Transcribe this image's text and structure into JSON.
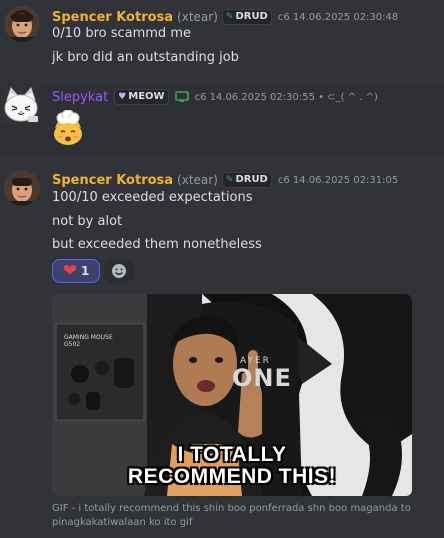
{
  "colors": {
    "background": "#313338",
    "spencer_name": "#f0b232",
    "slepykat_name": "#9b59f6",
    "tag_green": "#3ba55c",
    "reaction_border": "#5865f2",
    "reaction_bg": "#3c4270",
    "heart": "#ed4245"
  },
  "messages": [
    {
      "username": "Spencer Kotrosa",
      "handle": "(xtear)",
      "tag": "DRUD",
      "tag_icon": "feather-icon",
      "timestamp": "c6 14.06.2025 02:30:48",
      "lines": [
        "0/10 bro scammd me",
        "jk bro did an outstanding job"
      ]
    },
    {
      "username": "Slepykat",
      "tag": "MEOW",
      "tag_icon": "heart-icon",
      "device_icon": "monitor-icon",
      "timestamp": "c6 14.06.2025 02:30:55 • ⊂_( ^ . ^)",
      "emoji": "chef-cat-emoji"
    },
    {
      "username": "Spencer Kotrosa",
      "handle": "(xtear)",
      "tag": "DRUD",
      "tag_icon": "feather-icon",
      "timestamp": "c6 14.06.2025 02:31:05",
      "lines": [
        "100/10 exceeded expectations",
        "not by alot",
        "but exceeded them nonetheless"
      ],
      "reaction": {
        "emoji": "heart-emoji",
        "count": "1"
      },
      "add_reaction_icon": "smiley-plus-icon",
      "gif": {
        "caption_line1": "I TOTALLY",
        "caption_line2": "RECOMMEND THIS!",
        "poster_text": "GAMING MOUSE G502",
        "chair_text": "ONE",
        "chair_text_small": "AYER",
        "description": "GIF - i totally recommend this shin boo ponferrada shn boo maganda to pinagkakatiwalaan ko ito gif"
      }
    }
  ]
}
